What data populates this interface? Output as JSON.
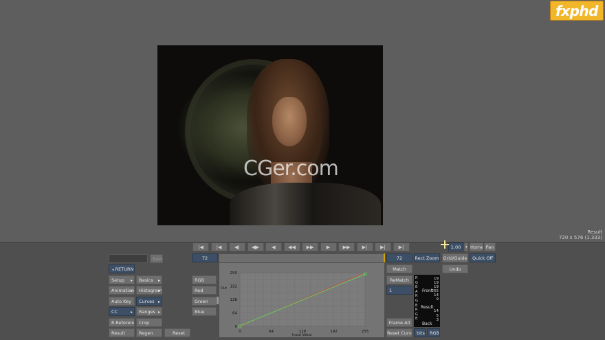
{
  "logo": "fxphd",
  "watermark": "CGer.com",
  "viewer": {
    "result_label": "Result",
    "resolution": "720 x 576 (1.333)"
  },
  "transport": [
    "|◀",
    "|◀",
    "◀|",
    "◀▶",
    "◀",
    "◀◀",
    "▶▶",
    "▶",
    "▶▶",
    "▶|",
    "▶|",
    "▶|"
  ],
  "left_buttons": {
    "name_field": "",
    "save": "Save",
    "return": "RETURN",
    "setup": "Setup",
    "basics": "Basics",
    "animation": "Animation",
    "histogram": "Histogram",
    "auto_key": "Auto Key",
    "curves": "Curves",
    "cc": "CC",
    "ranges": "Ranges",
    "r_reference": "R.Reference",
    "crop": "Crop",
    "result": "Result",
    "regen": "Regen",
    "reset": "Reset"
  },
  "channels": [
    "RGB",
    "Red",
    "Green",
    "Blue"
  ],
  "frame_left": "72",
  "frame_right": "72",
  "right_buttons": {
    "match": "Match",
    "rematch": "ReMatch",
    "field_value": "1",
    "frame_all": "Frame All",
    "reset_curve": "Reset Curve",
    "bits": "bits",
    "rgb": "RGB",
    "rect_zoom": "Rect Zoom",
    "grid_guide": "Grid/Guide",
    "undo": "Undo",
    "zoom": "1.00",
    "home": "Home",
    "pan": "Pan",
    "quick_off": "Quick Off"
  },
  "graph": {
    "y_label": "Out",
    "x_label": "Input Value",
    "y_ticks": [
      "255",
      "192",
      "128",
      "64",
      "0"
    ],
    "x_ticks": [
      "0",
      "64",
      "128",
      "192",
      "255"
    ]
  },
  "info_panel": {
    "letters": [
      "R",
      "G",
      "B",
      "A",
      "R",
      "G",
      "B",
      "R",
      "G",
      "B"
    ],
    "values": [
      "19",
      "19",
      "19",
      "255",
      "14",
      "9",
      "14",
      "5",
      "3"
    ],
    "front": "Front",
    "result": "Result",
    "back": "Back"
  },
  "colors": {
    "accent_blue": "#3d4f66",
    "curve_green": "#5fd15f",
    "curve_red": "#c85050",
    "marker": "#d4a200"
  }
}
